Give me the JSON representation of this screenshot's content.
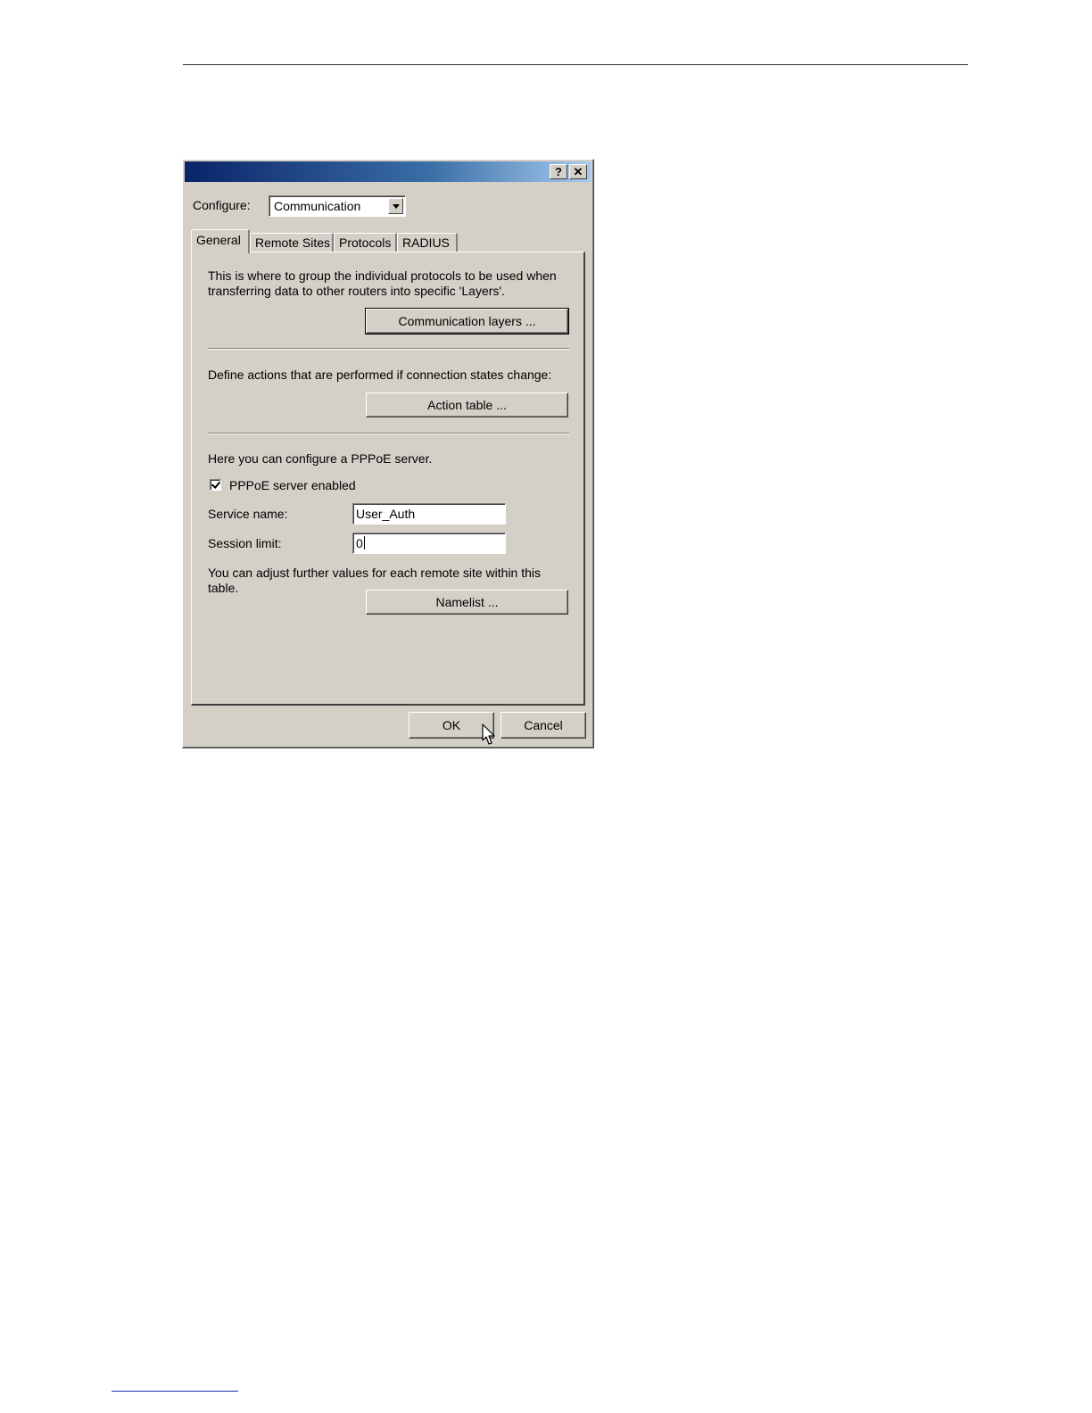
{
  "dialog": {
    "help_glyph": "?",
    "close_glyph": "✕",
    "configure_label": "Configure:",
    "configure_value": "Communication",
    "tabs": [
      {
        "label": "General",
        "active": true
      },
      {
        "label": "Remote Sites",
        "active": false
      },
      {
        "label": "Protocols",
        "active": false
      },
      {
        "label": "RADIUS",
        "active": false
      }
    ],
    "general": {
      "layers_text": "This is where to group the individual protocols to be used when transferring data to other routers into specific 'Layers'.",
      "layers_button": "Communication layers ...",
      "actions_text": "Define actions that are performed if connection states change:",
      "actions_button": "Action table ...",
      "pppoe_text": "Here you can configure a PPPoE server.",
      "pppoe_checkbox_label": "PPPoE server enabled",
      "pppoe_enabled": true,
      "service_name_label": "Service name:",
      "service_name_value": "User_Auth",
      "session_limit_label": "Session limit:",
      "session_limit_value": "0",
      "remote_text": "You can adjust further values for each remote site within this table.",
      "namelist_button": "Namelist ..."
    },
    "ok_button": "OK",
    "cancel_button": "Cancel"
  },
  "colors": {
    "dialog_face": "#d4d0c8",
    "title_gradient_start": "#0a246a",
    "title_gradient_end": "#a6caf0"
  },
  "icons": {
    "help": "help-icon",
    "close": "close-icon",
    "dropdown": "chevron-down-icon",
    "cursor": "mouse-pointer-icon"
  }
}
